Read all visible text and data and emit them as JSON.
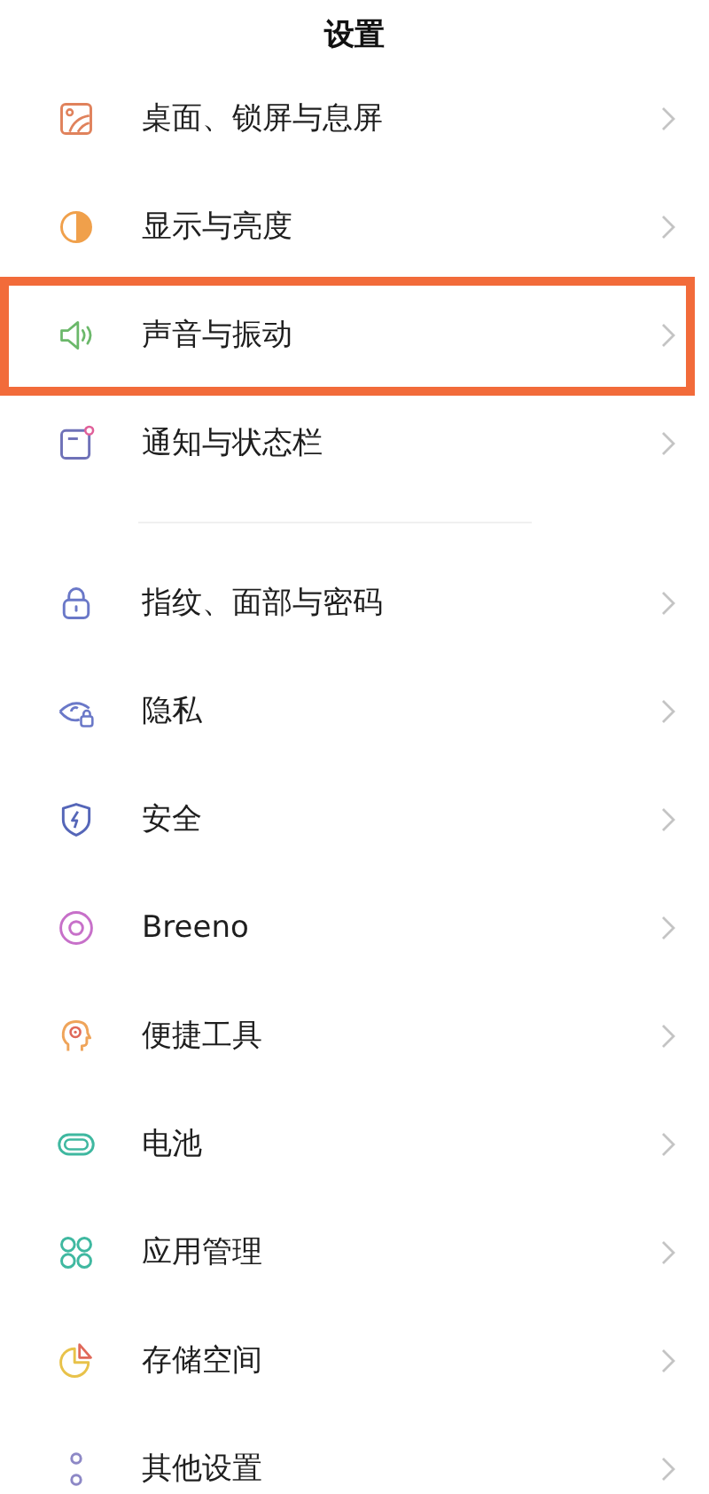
{
  "header": {
    "title": "设置"
  },
  "sections": [
    {
      "items": [
        {
          "label": "桌面、锁屏与息屏",
          "kind": "wallpaper",
          "highlighted": false
        },
        {
          "label": "显示与亮度",
          "kind": "brightness",
          "highlighted": false
        },
        {
          "label": "声音与振动",
          "kind": "sound",
          "highlighted": true
        },
        {
          "label": "通知与状态栏",
          "kind": "notification",
          "highlighted": false
        }
      ]
    },
    {
      "items": [
        {
          "label": "指纹、面部与密码",
          "kind": "lock",
          "highlighted": false
        },
        {
          "label": "隐私",
          "kind": "privacy",
          "highlighted": false
        },
        {
          "label": "安全",
          "kind": "security",
          "highlighted": false
        },
        {
          "label": "Breeno",
          "kind": "assistant",
          "highlighted": false
        },
        {
          "label": "便捷工具",
          "kind": "tools",
          "highlighted": false
        },
        {
          "label": "电池",
          "kind": "battery",
          "highlighted": false
        },
        {
          "label": "应用管理",
          "kind": "apps",
          "highlighted": false
        },
        {
          "label": "存储空间",
          "kind": "storage",
          "highlighted": false
        },
        {
          "label": "其他设置",
          "kind": "other",
          "highlighted": false
        }
      ]
    }
  ]
}
